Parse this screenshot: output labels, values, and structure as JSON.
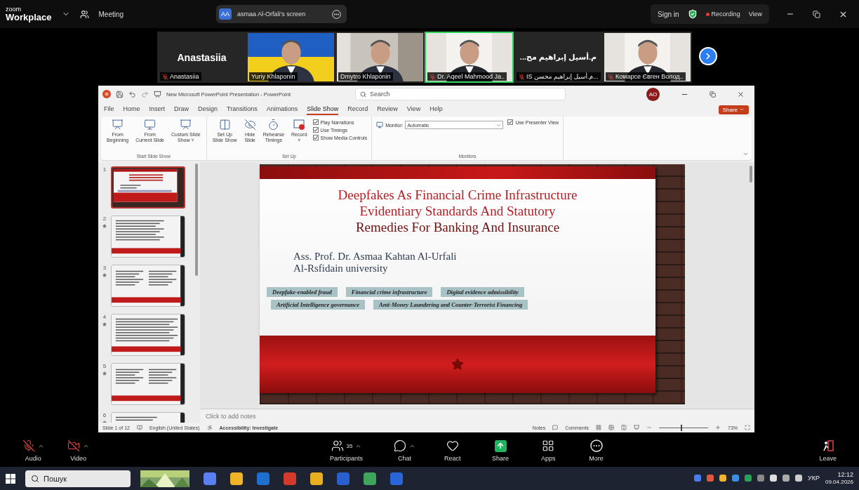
{
  "zoom_top": {
    "logo_top": "zoom",
    "logo": "Workplace",
    "meeting": "Meeting",
    "share_initials": "AA",
    "share_label": "asmaa Al-Orfali's screen",
    "sign_in": "Sign in",
    "recording": "Recording",
    "view": "View"
  },
  "video_tiles": [
    {
      "kind": "name",
      "display": "Anastasiia",
      "caption": "Anastasiia",
      "muted": true,
      "speaking": false
    },
    {
      "kind": "picture",
      "caption": "Yuriy Khlaponin",
      "muted": false,
      "speaking": false
    },
    {
      "kind": "picture",
      "caption": "Dmytro Khlaponin",
      "muted": false,
      "speaking": false
    },
    {
      "kind": "picture",
      "caption": "Dr. Aqeel Mahmood Ja..",
      "muted": true,
      "speaking": true
    },
    {
      "kind": "name",
      "display": "م.أسيل إبراهيم مح...",
      "caption": "IS م.أسيل إبراهيم محسن...",
      "muted": true,
      "speaking": false
    },
    {
      "kind": "picture",
      "caption": "Комарсе Євген Волод..",
      "muted": true,
      "speaking": false
    }
  ],
  "ppt": {
    "title": "New Microsoft PowerPoint Presentation - PowerPoint",
    "search": {
      "placeholder": "Search"
    },
    "avatar": "AO",
    "tabs": [
      {
        "label": "File",
        "selected": false
      },
      {
        "label": "Home",
        "selected": false
      },
      {
        "label": "Insert",
        "selected": false
      },
      {
        "label": "Draw",
        "selected": false
      },
      {
        "label": "Design",
        "selected": false
      },
      {
        "label": "Transitions",
        "selected": false
      },
      {
        "label": "Animations",
        "selected": false
      },
      {
        "label": "Slide Show",
        "selected": true
      },
      {
        "label": "Record",
        "selected": false
      },
      {
        "label": "Review",
        "selected": false
      },
      {
        "label": "View",
        "selected": false
      },
      {
        "label": "Help",
        "selected": false
      }
    ],
    "share": "Share",
    "ribbon_groups": [
      {
        "label": "Start Slide Show",
        "items": [
          {
            "kind": "large",
            "label": "From\nBeginning"
          },
          {
            "kind": "large",
            "label": "From\nCurrent Slide"
          },
          {
            "kind": "large",
            "label": "Custom Slide\nShow ˅"
          }
        ]
      },
      {
        "label": "Set Up",
        "items": [
          {
            "kind": "large",
            "label": "Set Up\nSlide Show"
          },
          {
            "kind": "large",
            "label": "Hide\nSlide"
          },
          {
            "kind": "large",
            "label": "Rehearse\nTimings"
          },
          {
            "kind": "large",
            "label": "Record\n˅"
          },
          {
            "kind": "checks",
            "checks": [
              {
                "label": "Play Narrations",
                "checked": true
              },
              {
                "label": "Use Timings",
                "checked": true
              },
              {
                "label": "Show Media Controls",
                "checked": true
              }
            ]
          }
        ]
      },
      {
        "label": "Monitors",
        "items": [
          {
            "kind": "monitor",
            "label": "Monitor:",
            "value": "Automatic"
          },
          {
            "kind": "checks",
            "checks": [
              {
                "label": "Use Presenter View",
                "checked": true
              }
            ]
          }
        ]
      }
    ],
    "thumbnails": [
      {
        "number": "1",
        "kind": "title",
        "selected": true,
        "animated": false
      },
      {
        "number": "2",
        "kind": "bullets",
        "selected": false,
        "animated": true
      },
      {
        "number": "3",
        "kind": "columns",
        "selected": false,
        "animated": true
      },
      {
        "number": "4",
        "kind": "text",
        "selected": false,
        "animated": true
      },
      {
        "number": "5",
        "kind": "columns",
        "selected": false,
        "animated": true
      },
      {
        "number": "6",
        "kind": "heading",
        "selected": false,
        "animated": true
      }
    ],
    "slide": {
      "title_lines": [
        "Deepfakes As Financial Crime Infrastructure",
        "Evidentiary Standards And Statutory",
        "Remedies For Banking And Insurance"
      ],
      "author": "Ass. Prof. Dr. Asmaa Kahtan Al-Urfali",
      "affiliation": "Al-Rsfidain university",
      "tag_rows": [
        [
          "Deepfake-enabled fraud",
          "Financial crime infrastructure",
          "Digital evidence admissibility"
        ],
        [
          "Artificial Intelligence governance",
          "Anti-Money Laundering and Counter-Terrorist Financing"
        ]
      ]
    },
    "notes_placeholder": "Click to add notes",
    "status": {
      "slide": "Slide 1 of 12",
      "language": "English (United States)",
      "accessibility": "Accessibility: Investigate",
      "notes": "Notes",
      "comments": "Comments",
      "zoom": "73%",
      "zoom_level": {
        "level": 0.45
      }
    }
  },
  "controls": [
    {
      "kind": "audio",
      "label": "Audio",
      "caret": true
    },
    {
      "kind": "video",
      "label": "Video",
      "caret": true
    },
    {
      "kind": "participants",
      "label": "Participants",
      "count": "35",
      "caret": true
    },
    {
      "kind": "chat",
      "label": "Chat",
      "caret": true
    },
    {
      "kind": "react",
      "label": "React",
      "caret": false
    },
    {
      "kind": "share",
      "label": "Share",
      "caret": false
    },
    {
      "kind": "apps",
      "label": "Apps",
      "caret": false
    },
    {
      "kind": "more",
      "label": "More",
      "caret": false
    },
    {
      "kind": "leave",
      "label": "Leave",
      "caret": false
    }
  ],
  "taskbar": {
    "search": "Пошук",
    "language": "УКР",
    "time": "12:12",
    "date": "09.04.2026"
  }
}
